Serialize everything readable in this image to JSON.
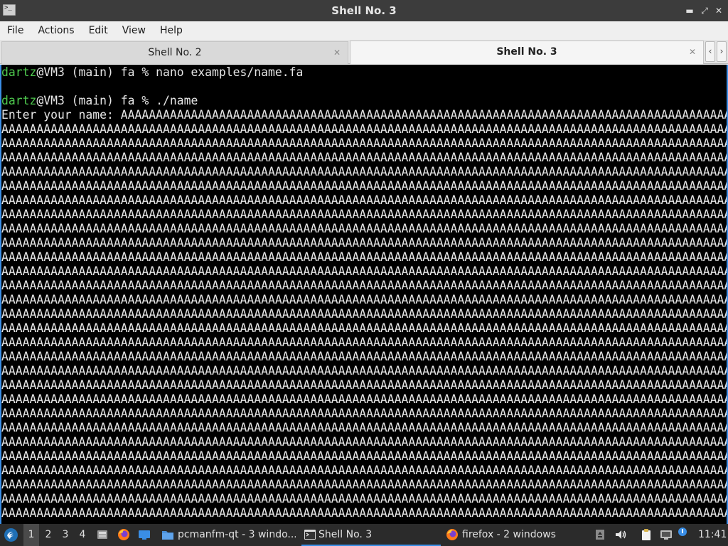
{
  "window": {
    "title": "Shell No. 3",
    "controls": {
      "minimize": "▬",
      "restore": "⤢",
      "close": "✕"
    }
  },
  "menu": [
    "File",
    "Actions",
    "Edit",
    "View",
    "Help"
  ],
  "tabs": [
    {
      "label": "Shell No. 2",
      "active": false
    },
    {
      "label": "Shell No. 3",
      "active": true
    }
  ],
  "tab_scroll": {
    "left": "‹",
    "right": "›"
  },
  "terminal": {
    "colors": {
      "background": "#000000",
      "text": "#e5e5e5",
      "prompt_user": "#4ec94e"
    },
    "lines": [
      {
        "user": "dartz",
        "text": "@VM3 (main) fa % nano examples/name.fa"
      },
      {
        "text": ""
      },
      {
        "user": "dartz",
        "text": "@VM3 (main) fa % ./name"
      },
      {
        "text": "Enter your name: AAAAAAAAAAAAAAAAAAAAAAAAAAAAAAAAAAAAAAAAAAAAAAAAAAAAAAAAAAAAAAAAAAAAAAAAAAAAAAAAAAAAAAAAAA"
      },
      {
        "text": "AAAAAAAAAAAAAAAAAAAAAAAAAAAAAAAAAAAAAAAAAAAAAAAAAAAAAAAAAAAAAAAAAAAAAAAAAAAAAAAAAAAAAAAAAAAAAAAAAAAAAAAA"
      },
      {
        "text": "AAAAAAAAAAAAAAAAAAAAAAAAAAAAAAAAAAAAAAAAAAAAAAAAAAAAAAAAAAAAAAAAAAAAAAAAAAAAAAAAAAAAAAAAAAAAAAAAAAAAAAAA"
      },
      {
        "text": "AAAAAAAAAAAAAAAAAAAAAAAAAAAAAAAAAAAAAAAAAAAAAAAAAAAAAAAAAAAAAAAAAAAAAAAAAAAAAAAAAAAAAAAAAAAAAAAAAAAAAAAA"
      },
      {
        "text": "AAAAAAAAAAAAAAAAAAAAAAAAAAAAAAAAAAAAAAAAAAAAAAAAAAAAAAAAAAAAAAAAAAAAAAAAAAAAAAAAAAAAAAAAAAAAAAAAAAAAAAAA"
      },
      {
        "text": "AAAAAAAAAAAAAAAAAAAAAAAAAAAAAAAAAAAAAAAAAAAAAAAAAAAAAAAAAAAAAAAAAAAAAAAAAAAAAAAAAAAAAAAAAAAAAAAAAAAAAAAA"
      },
      {
        "text": "AAAAAAAAAAAAAAAAAAAAAAAAAAAAAAAAAAAAAAAAAAAAAAAAAAAAAAAAAAAAAAAAAAAAAAAAAAAAAAAAAAAAAAAAAAAAAAAAAAAAAAAA"
      },
      {
        "text": "AAAAAAAAAAAAAAAAAAAAAAAAAAAAAAAAAAAAAAAAAAAAAAAAAAAAAAAAAAAAAAAAAAAAAAAAAAAAAAAAAAAAAAAAAAAAAAAAAAAAAAAA"
      },
      {
        "text": "AAAAAAAAAAAAAAAAAAAAAAAAAAAAAAAAAAAAAAAAAAAAAAAAAAAAAAAAAAAAAAAAAAAAAAAAAAAAAAAAAAAAAAAAAAAAAAAAAAAAAAAA"
      },
      {
        "text": "AAAAAAAAAAAAAAAAAAAAAAAAAAAAAAAAAAAAAAAAAAAAAAAAAAAAAAAAAAAAAAAAAAAAAAAAAAAAAAAAAAAAAAAAAAAAAAAAAAAAAAAA"
      },
      {
        "text": "AAAAAAAAAAAAAAAAAAAAAAAAAAAAAAAAAAAAAAAAAAAAAAAAAAAAAAAAAAAAAAAAAAAAAAAAAAAAAAAAAAAAAAAAAAAAAAAAAAAAAAAA"
      },
      {
        "text": "AAAAAAAAAAAAAAAAAAAAAAAAAAAAAAAAAAAAAAAAAAAAAAAAAAAAAAAAAAAAAAAAAAAAAAAAAAAAAAAAAAAAAAAAAAAAAAAAAAAAAAAA"
      },
      {
        "text": "AAAAAAAAAAAAAAAAAAAAAAAAAAAAAAAAAAAAAAAAAAAAAAAAAAAAAAAAAAAAAAAAAAAAAAAAAAAAAAAAAAAAAAAAAAAAAAAAAAAAAAAA"
      },
      {
        "text": "AAAAAAAAAAAAAAAAAAAAAAAAAAAAAAAAAAAAAAAAAAAAAAAAAAAAAAAAAAAAAAAAAAAAAAAAAAAAAAAAAAAAAAAAAAAAAAAAAAAAAAAA"
      },
      {
        "text": "AAAAAAAAAAAAAAAAAAAAAAAAAAAAAAAAAAAAAAAAAAAAAAAAAAAAAAAAAAAAAAAAAAAAAAAAAAAAAAAAAAAAAAAAAAAAAAAAAAAAAAAA"
      },
      {
        "text": "AAAAAAAAAAAAAAAAAAAAAAAAAAAAAAAAAAAAAAAAAAAAAAAAAAAAAAAAAAAAAAAAAAAAAAAAAAAAAAAAAAAAAAAAAAAAAAAAAAAAAAAA"
      },
      {
        "text": "AAAAAAAAAAAAAAAAAAAAAAAAAAAAAAAAAAAAAAAAAAAAAAAAAAAAAAAAAAAAAAAAAAAAAAAAAAAAAAAAAAAAAAAAAAAAAAAAAAAAAAAA"
      },
      {
        "text": "AAAAAAAAAAAAAAAAAAAAAAAAAAAAAAAAAAAAAAAAAAAAAAAAAAAAAAAAAAAAAAAAAAAAAAAAAAAAAAAAAAAAAAAAAAAAAAAAAAAAAAAA"
      },
      {
        "text": "AAAAAAAAAAAAAAAAAAAAAAAAAAAAAAAAAAAAAAAAAAAAAAAAAAAAAAAAAAAAAAAAAAAAAAAAAAAAAAAAAAAAAAAAAAAAAAAAAAAAAAAA"
      },
      {
        "text": "AAAAAAAAAAAAAAAAAAAAAAAAAAAAAAAAAAAAAAAAAAAAAAAAAAAAAAAAAAAAAAAAAAAAAAAAAAAAAAAAAAAAAAAAAAAAAAAAAAAAAAAA"
      },
      {
        "text": "AAAAAAAAAAAAAAAAAAAAAAAAAAAAAAAAAAAAAAAAAAAAAAAAAAAAAAAAAAAAAAAAAAAAAAAAAAAAAAAAAAAAAAAAAAAAAAAAAAAAAAAA"
      },
      {
        "text": "AAAAAAAAAAAAAAAAAAAAAAAAAAAAAAAAAAAAAAAAAAAAAAAAAAAAAAAAAAAAAAAAAAAAAAAAAAAAAAAAAAAAAAAAAAAAAAAAAAAAAAAA"
      },
      {
        "text": "AAAAAAAAAAAAAAAAAAAAAAAAAAAAAAAAAAAAAAAAAAAAAAAAAAAAAAAAAAAAAAAAAAAAAAAAAAAAAAAAAAAAAAAAAAAAAAAAAAAAAAAA"
      },
      {
        "text": "AAAAAAAAAAAAAAAAAAAAAAAAAAAAAAAAAAAAAAAAAAAAAAAAAAAAAAAAAAAAAAAAAAAAAAAAAAAAAAAAAAAAAAAAAAAAAAAAAAAAAAAA"
      },
      {
        "text": "AAAAAAAAAAAAAAAAAAAAAAAAAAAAAAAAAAAAAAAAAAAAAAAAAAAAAAAAAAAAAAAAAAAAAAAAAAAAAAAAAAAAAAAAAAAAAAAAAAAAAAAA"
      },
      {
        "text": "AAAAAAAAAAAAAAAAAAAAAAAAAAAAAAAAAAAAAAAAAAAAAAAAAAAAAAAAAAAAAAAAAAAAAAAAAAAAAAAAAAAAAAAAAAAAAAAAAAAAAAAA"
      },
      {
        "text": "AAAAAAAAAAAAAAAAAAAAAAAAAAAAAAAAAAAAAAAAAAAAAAAAAAAAAAAAAAAAAAAAAAAAAAAAAAAAAAAAAAAAAAAAAAAAAAAAAAAAAAAA"
      },
      {
        "text": "AAAAAAAAAAAAAAAAAAAAAAAAAAAAAAAAAAAAAAAAAAAAAAAAAAAAAAAAAAAAAAAAAAAAAAAAAAAAAAAAAAAAAAAAAAAAAAAAAAAAAAAA"
      },
      {
        "text": "AAAAAAAAAAAAAAAAAAAAAAAAAAAAAAAAAAAAAAAAAAAAAAAAAAAAAAAAAAAAAAAAAAAAAAAAAAAAAAAAAAAAAAAAAAAAAAAAAAAAAAAA"
      }
    ]
  },
  "taskbar": {
    "desktops": [
      {
        "label": "1",
        "active": true
      },
      {
        "label": "2",
        "active": false
      },
      {
        "label": "3",
        "active": false
      },
      {
        "label": "4",
        "active": false
      }
    ],
    "tasks": [
      {
        "label": "pcmanfm-qt - 3 windo...",
        "icon": "folder-icon",
        "active": false
      },
      {
        "label": "Shell No. 3",
        "icon": "terminal-icon",
        "active": true
      },
      {
        "label": "firefox - 2 windows",
        "icon": "firefox-icon",
        "active": false
      }
    ],
    "clock": "11:41"
  }
}
